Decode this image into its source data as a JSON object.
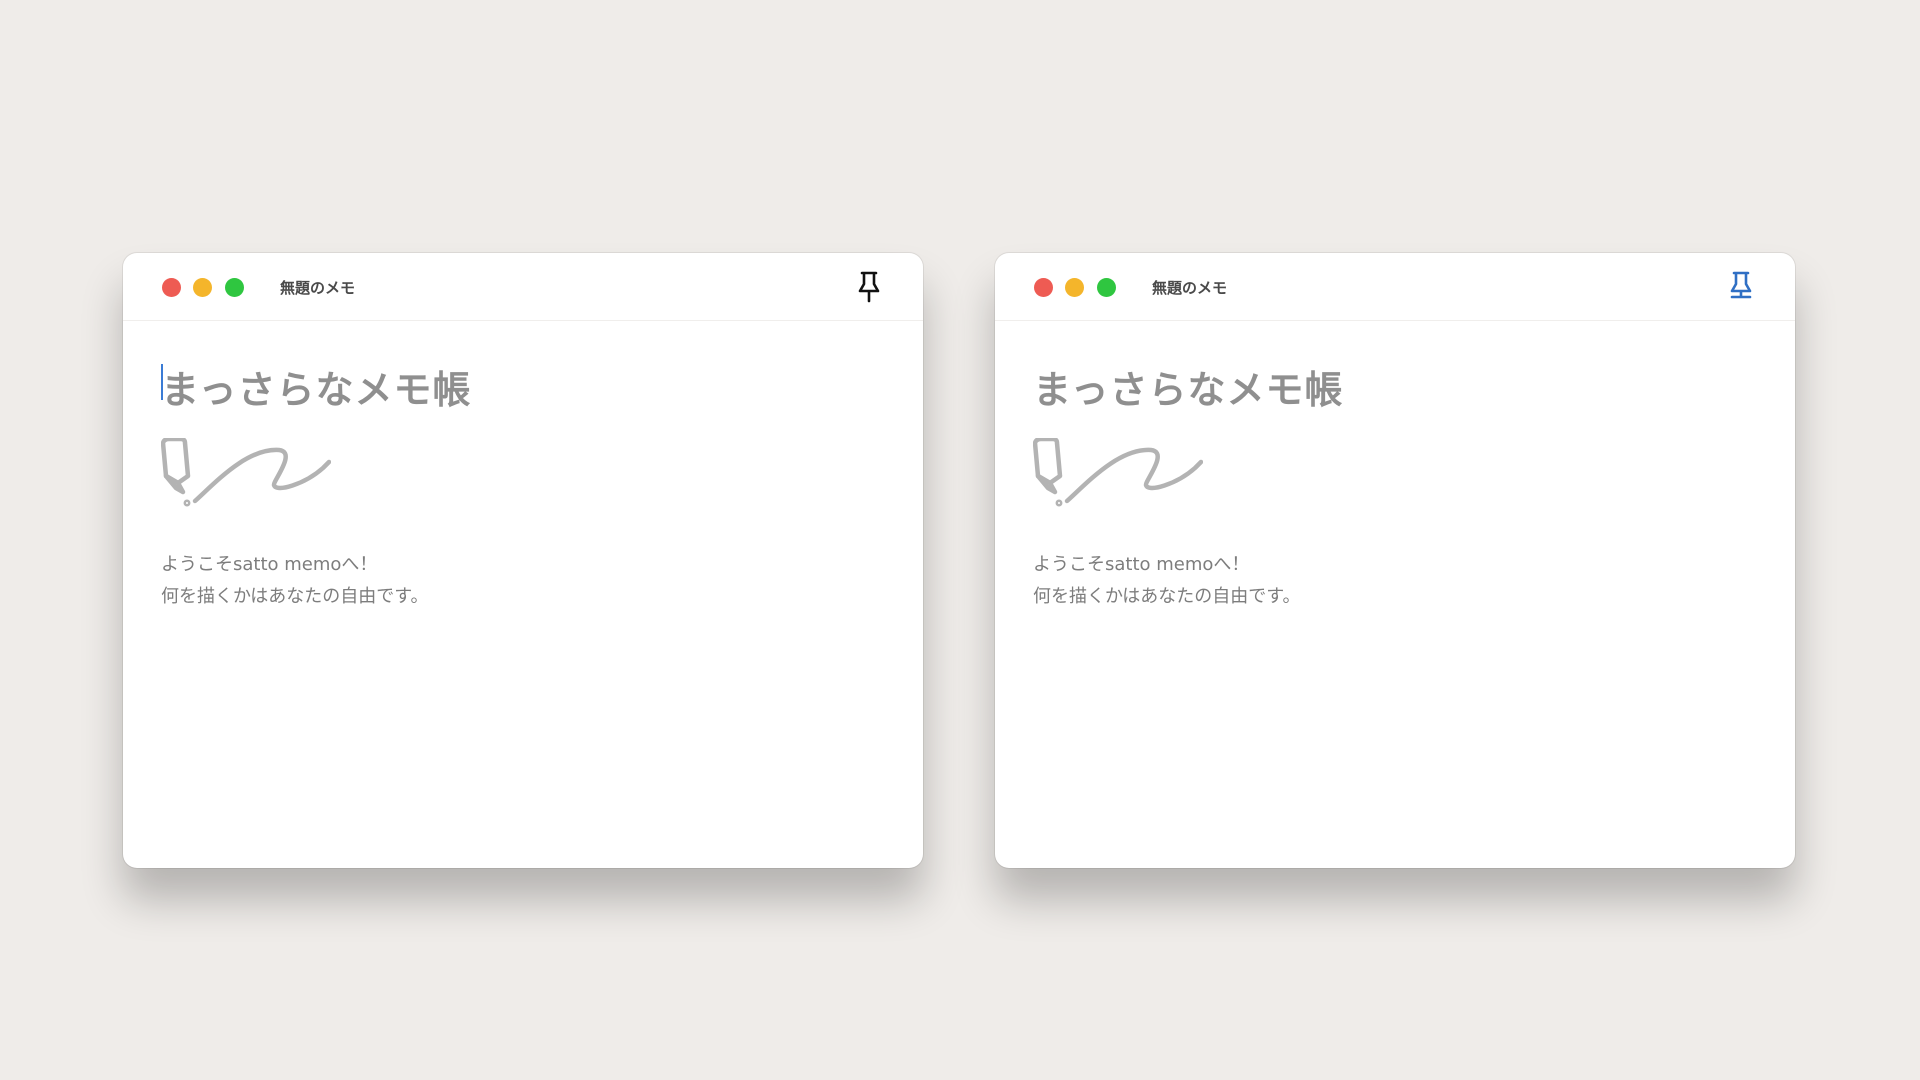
{
  "windows": [
    {
      "title": "無題のメモ",
      "pin_state": "unpinned",
      "pin_color": "#111111",
      "heading": "まっさらなメモ帳",
      "welcome_line": "ようこそsatto memoへ！",
      "description_line": "何を描くかはあなたの自由です。",
      "text_cursor_visible": true
    },
    {
      "title": "無題のメモ",
      "pin_state": "pinned",
      "pin_color": "#2f6fc4",
      "heading": "まっさらなメモ帳",
      "welcome_line": "ようこそsatto memoへ！",
      "description_line": "何を描くかはあなたの自由です。",
      "text_cursor_visible": false
    }
  ],
  "colors": {
    "background": "#efece9",
    "close_button": "#ee5b53",
    "minimize_button": "#f4b52b",
    "zoom_button": "#2fc640",
    "placeholder_text": "#8f8f8f",
    "caret": "#3a7bd5"
  },
  "icons": {
    "pin": "pushpin-icon",
    "illustration": "pen-scribble-icon"
  }
}
